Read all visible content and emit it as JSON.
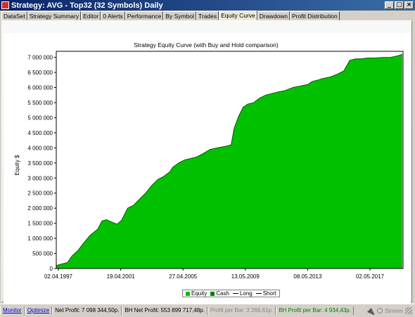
{
  "window": {
    "title": "Strategy: AVG - Top32 (32 Symbols) Daily",
    "minimize": "_",
    "maximize": "□",
    "close": "×"
  },
  "tabs": [
    {
      "label": "DataSet"
    },
    {
      "label": "Strategy Summary"
    },
    {
      "label": "Editor"
    },
    {
      "label": "0 Alerts"
    },
    {
      "label": "Performance"
    },
    {
      "label": "By Symbol"
    },
    {
      "label": "Trades"
    },
    {
      "label": "Equity Curve",
      "active": true
    },
    {
      "label": "Drawdown"
    },
    {
      "label": "Profit Distribution"
    }
  ],
  "chart_data": {
    "type": "area",
    "title": "Strategy Equity Curve (with Buy and Hold comparison)",
    "ylabel": "Equity $",
    "xlabel": "",
    "ylim": [
      0,
      7200000
    ],
    "yticks": [
      0,
      500000,
      1000000,
      1500000,
      2000000,
      2500000,
      3000000,
      3500000,
      4000000,
      4500000,
      5000000,
      5500000,
      6000000,
      6500000,
      7000000
    ],
    "ytick_labels": [
      "0",
      "500 000",
      "1 000 000",
      "1 500 000",
      "2 000 000",
      "2 500 000",
      "3 000 000",
      "3 500 000",
      "4 000 000",
      "4 500 000",
      "5 000 000",
      "5 500 000",
      "6 000 000",
      "6 500 000",
      "7 000 000"
    ],
    "xtick_labels": [
      "02.04.1997",
      "19.04.2001",
      "27.04.2005",
      "13.05.2009",
      "08.05.2013",
      "02.05.2017"
    ],
    "x": [
      1997.25,
      1997.6,
      1998.0,
      1998.3,
      1998.7,
      1999.0,
      1999.5,
      2000.0,
      2000.3,
      2000.6,
      2000.9,
      2001.3,
      2001.6,
      2002.0,
      2002.4,
      2002.8,
      2003.2,
      2003.6,
      2004.0,
      2004.4,
      2004.8,
      2005.0,
      2005.4,
      2005.8,
      2006.2,
      2006.6,
      2007.0,
      2007.5,
      2008.0,
      2008.5,
      2008.9,
      2009.1,
      2009.4,
      2009.7,
      2010.0,
      2010.4,
      2010.8,
      2011.2,
      2011.6,
      2012.0,
      2012.5,
      2013.0,
      2013.5,
      2014.0,
      2014.3,
      2014.7,
      2015.0,
      2015.5,
      2016.0,
      2016.4,
      2016.8,
      2017.2,
      2017.6,
      2018.0,
      2018.5,
      2019.0,
      2019.5,
      2020.0,
      2020.3
    ],
    "series": [
      {
        "name": "Equity",
        "color": "#00c000",
        "values": [
          100000,
          150000,
          200000,
          420000,
          600000,
          800000,
          1100000,
          1300000,
          1580000,
          1620000,
          1550000,
          1470000,
          1600000,
          2000000,
          2100000,
          2300000,
          2500000,
          2750000,
          2950000,
          3050000,
          3200000,
          3350000,
          3500000,
          3600000,
          3650000,
          3700000,
          3800000,
          3950000,
          4000000,
          4050000,
          4100000,
          4650000,
          5050000,
          5350000,
          5450000,
          5500000,
          5650000,
          5750000,
          5800000,
          5850000,
          5900000,
          6000000,
          6050000,
          6100000,
          6200000,
          6250000,
          6300000,
          6350000,
          6450000,
          6550000,
          6900000,
          6950000,
          6950000,
          6980000,
          6980000,
          7000000,
          7000000,
          7050000,
          7100000
        ]
      }
    ],
    "legend": [
      {
        "label": "Equity",
        "kind": "box",
        "color": "#00c000"
      },
      {
        "label": "Cash",
        "kind": "box",
        "color": "#008000"
      },
      {
        "label": "Long",
        "kind": "line",
        "color": "#000000"
      },
      {
        "label": "Short",
        "kind": "line",
        "color": "#000000"
      }
    ],
    "legend_position": "bottom-center",
    "grid": false
  },
  "status": {
    "monitor": "Monitor",
    "optimize": "Optimize",
    "net_profit": "Net Profit: 7 098 344,50p.",
    "bh_net_profit": "BH Net Profit: 553 899 717,48p.",
    "profit_per_bar": "Profit per Bar: 3 266,61p.",
    "bh_profit_per_bar": "BH Profit per Bar: 4 934,43p.",
    "stream": "Stream"
  }
}
